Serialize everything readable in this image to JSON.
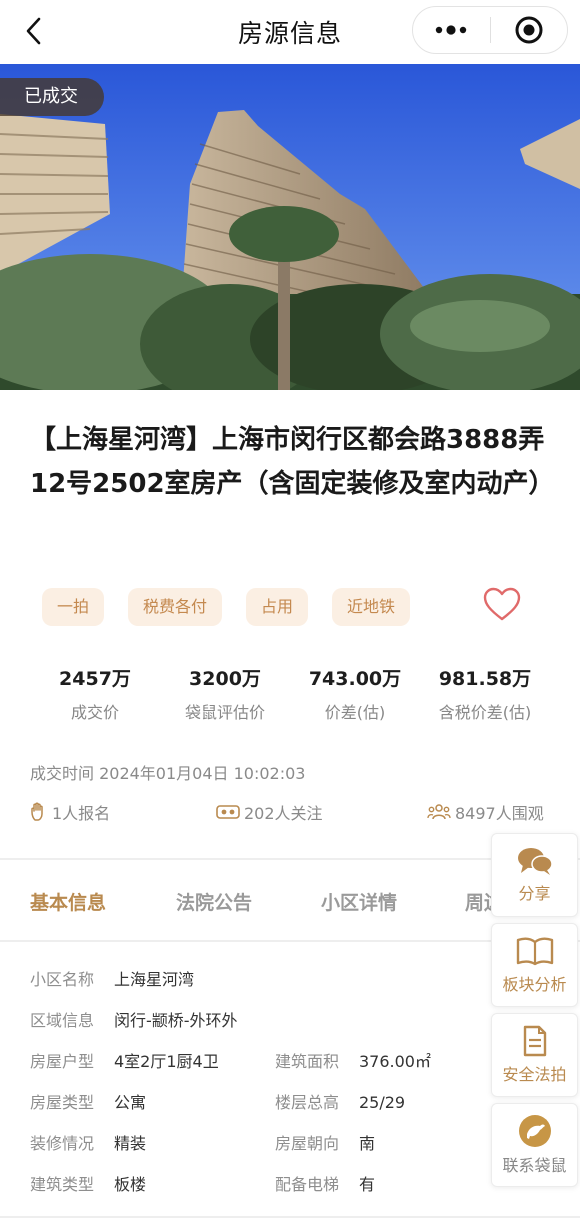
{
  "nav": {
    "title": "房源信息"
  },
  "hero": {
    "badge": "已成交"
  },
  "listing": {
    "title": "【上海星河湾】上海市闵行区都会路3888弄12号2502室房产（含固定装修及室内动产）",
    "tags": [
      "一拍",
      "税费各付",
      "占用",
      "近地铁"
    ]
  },
  "stats": [
    {
      "value": "2457万",
      "label": "成交价"
    },
    {
      "value": "3200万",
      "label": "袋鼠评估价"
    },
    {
      "value": "743.00万",
      "label": "价差(估)"
    },
    {
      "value": "981.58万",
      "label": "含税价差(估)"
    }
  ],
  "deal_time": "成交时间 2024年01月04日 10:02:03",
  "counts": {
    "signups": "1人报名",
    "follows": "202人关注",
    "watchers": "8497人围观"
  },
  "tabs": [
    "基本信息",
    "法院公告",
    "小区详情",
    "周边"
  ],
  "info": {
    "community": {
      "key": "小区名称",
      "value": "上海星河湾"
    },
    "region": {
      "key": "区域信息",
      "value": "闵行-颛桥-外环外"
    },
    "layout": {
      "key": "房屋户型",
      "value": "4室2厅1厨4卫"
    },
    "area": {
      "key": "建筑面积",
      "value": "376.00㎡"
    },
    "house_type": {
      "key": "房屋类型",
      "value": "公寓"
    },
    "floors": {
      "key": "楼层总高",
      "value": "25/29"
    },
    "decoration": {
      "key": "装修情况",
      "value": "精装"
    },
    "orientation": {
      "key": "房屋朝向",
      "value": "南"
    },
    "building_type": {
      "key": "建筑类型",
      "value": "板楼"
    },
    "elevator": {
      "key": "配备电梯",
      "value": "有"
    }
  },
  "side_actions": {
    "share": "分享",
    "block_analysis": "板块分析",
    "safe_auction": "安全法拍",
    "contact": "联系袋鼠"
  },
  "colors": {
    "accent": "#b98a4f",
    "tag_bg": "#fbefe3",
    "tag_text": "#c4894f",
    "heart": "#e06a6a"
  }
}
